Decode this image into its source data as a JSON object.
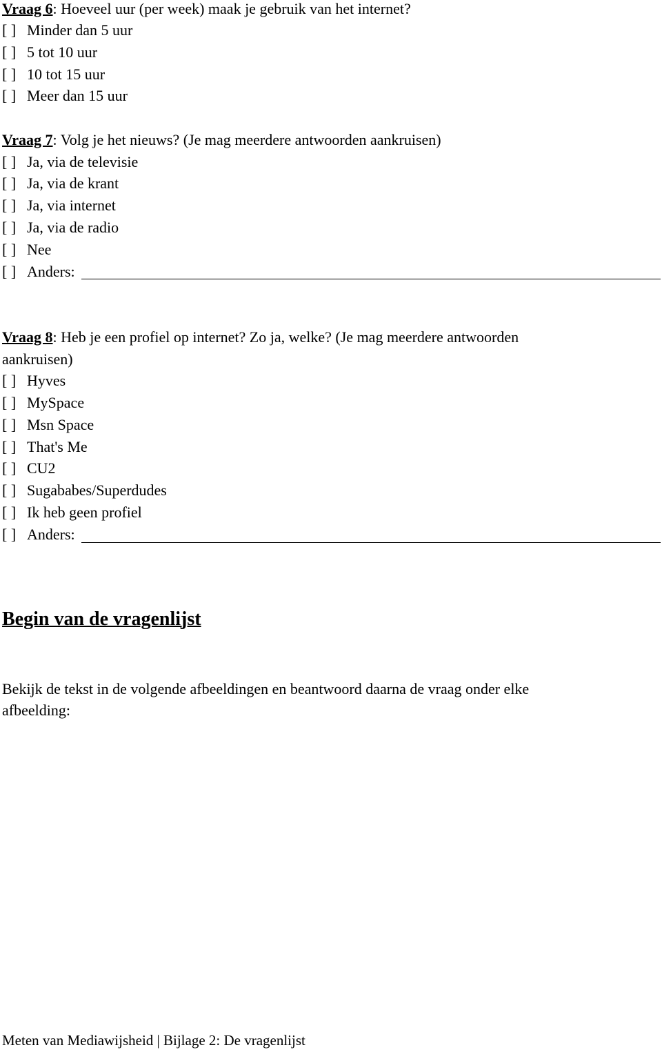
{
  "questions": [
    {
      "label": "Vraag 6",
      "text": ": Hoeveel uur (per week) maak je gebruik van het internet?",
      "options": [
        "Minder dan 5 uur",
        "5 tot 10 uur",
        "10 tot 15 uur",
        "Meer dan 15 uur"
      ]
    },
    {
      "label": "Vraag 7",
      "text": ": Volg je het nieuws? (Je mag meerdere antwoorden aankruisen)",
      "options": [
        "Ja, via de televisie",
        "Ja, via de krant",
        "Ja, via internet",
        "Ja, via de radio",
        "Nee",
        "Anders:"
      ]
    },
    {
      "label": "Vraag 8",
      "text": ": Heb je een profiel op internet? Zo ja, welke? (Je mag meerdere antwoorden",
      "text_continued": "aankruisen)",
      "options": [
        "Hyves",
        "MySpace",
        "Msn Space",
        "That's Me",
        "CU2",
        "Sugababes/Superdudes",
        "Ik heb geen profiel",
        "Anders:"
      ]
    }
  ],
  "checkbox_symbol": "[  ]",
  "section": {
    "heading": "Begin van de vragenlijst",
    "intro_line1": "Bekijk de tekst in de volgende afbeeldingen en beantwoord daarna de vraag onder elke",
    "intro_line2": "afbeelding:"
  },
  "footer": {
    "text": "Meten van Mediawijsheid | Bijlage 2: De vragenlijst"
  }
}
